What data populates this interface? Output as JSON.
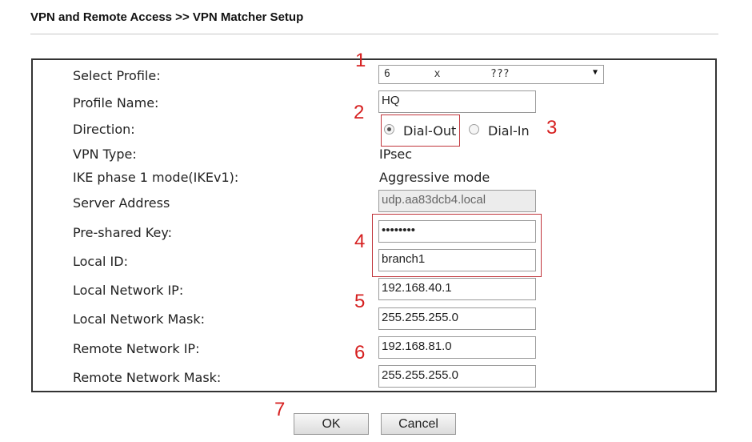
{
  "header": {
    "title": "VPN and Remote Access >> VPN Matcher Setup"
  },
  "form": {
    "select_profile": {
      "label": "Select Profile:",
      "value": "6       x        ???"
    },
    "profile_name": {
      "label": "Profile Name:",
      "value": "HQ"
    },
    "direction": {
      "label": "Direction:",
      "option_dialout": "Dial-Out",
      "option_dialin": "Dial-In",
      "selected": "Dial-Out"
    },
    "vpn_type": {
      "label": "VPN Type:",
      "value": "IPsec"
    },
    "ike_mode": {
      "label": "IKE phase 1 mode(IKEv1):",
      "value": "Aggressive mode"
    },
    "server_address": {
      "label": "Server Address",
      "value": "udp.aa83dcb4.local"
    },
    "preshared_key": {
      "label": "Pre-shared Key:",
      "value": "••••••••"
    },
    "local_id": {
      "label": "Local ID:",
      "value": "branch1"
    },
    "local_network_ip": {
      "label": "Local Network IP:",
      "value": "192.168.40.1"
    },
    "local_network_mask": {
      "label": "Local Network Mask:",
      "value": "255.255.255.0"
    },
    "remote_network_ip": {
      "label": "Remote Network IP:",
      "value": "192.168.81.0"
    },
    "remote_network_mask": {
      "label": "Remote Network Mask:",
      "value": "255.255.255.0"
    }
  },
  "callouts": [
    "1",
    "2",
    "3",
    "4",
    "5",
    "6",
    "7"
  ],
  "buttons": {
    "ok": "OK",
    "cancel": "Cancel"
  },
  "colors": {
    "callout": "#d62020",
    "highlight_border": "#c0353b"
  }
}
